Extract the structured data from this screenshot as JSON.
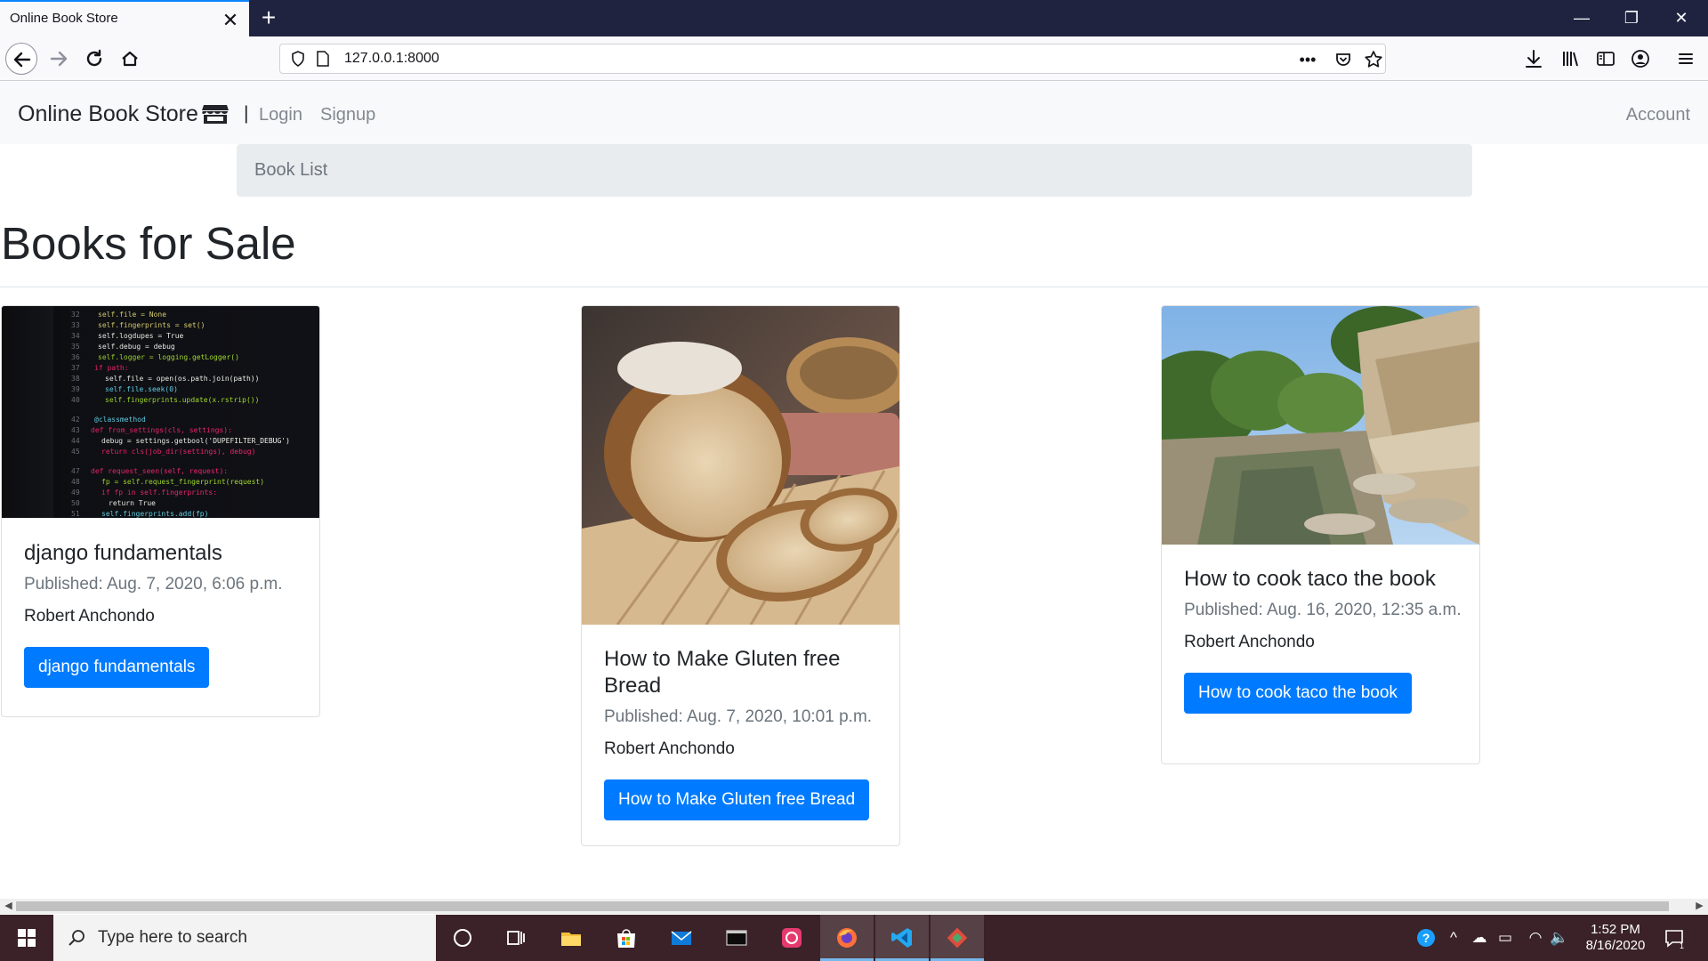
{
  "browser": {
    "tab_title": "Online Book Store",
    "close_tab_glyph": "✕",
    "new_tab_glyph": "+",
    "url": "127.0.0.1:8000",
    "window_controls": [
      "—",
      "❐",
      "✕"
    ]
  },
  "site": {
    "brand": "Online Book Store",
    "brand_icon": "store-icon",
    "separator": "|",
    "nav": {
      "login": "Login",
      "signup": "Signup",
      "account": "Account"
    },
    "breadcrumb": "Book List",
    "page_title": "Books for Sale"
  },
  "books": [
    {
      "title": "django fundamentals",
      "published": "Published: Aug. 7, 2020, 6:06 p.m.",
      "author": "Robert Anchondo",
      "button": "django fundamentals",
      "image": "code-on-screen"
    },
    {
      "title": "How to Make Gluten free Bread",
      "published": "Published: Aug. 7, 2020, 10:01 p.m.",
      "author": "Robert Anchondo",
      "button": "How to Make Gluten free Bread",
      "image": "bread-loaf"
    },
    {
      "title": "How to cook taco the book",
      "published": "Published: Aug. 16, 2020, 12:35 a.m.",
      "author": "Robert Anchondo",
      "button": "How to cook taco the book",
      "image": "creek-landscape"
    }
  ],
  "taskbar": {
    "search_placeholder": "Type here to search",
    "time": "1:52 PM",
    "date": "8/16/2020"
  },
  "colors": {
    "primary": "#007bff",
    "chrome_dark": "#202340",
    "taskbar": "#3a2228"
  }
}
